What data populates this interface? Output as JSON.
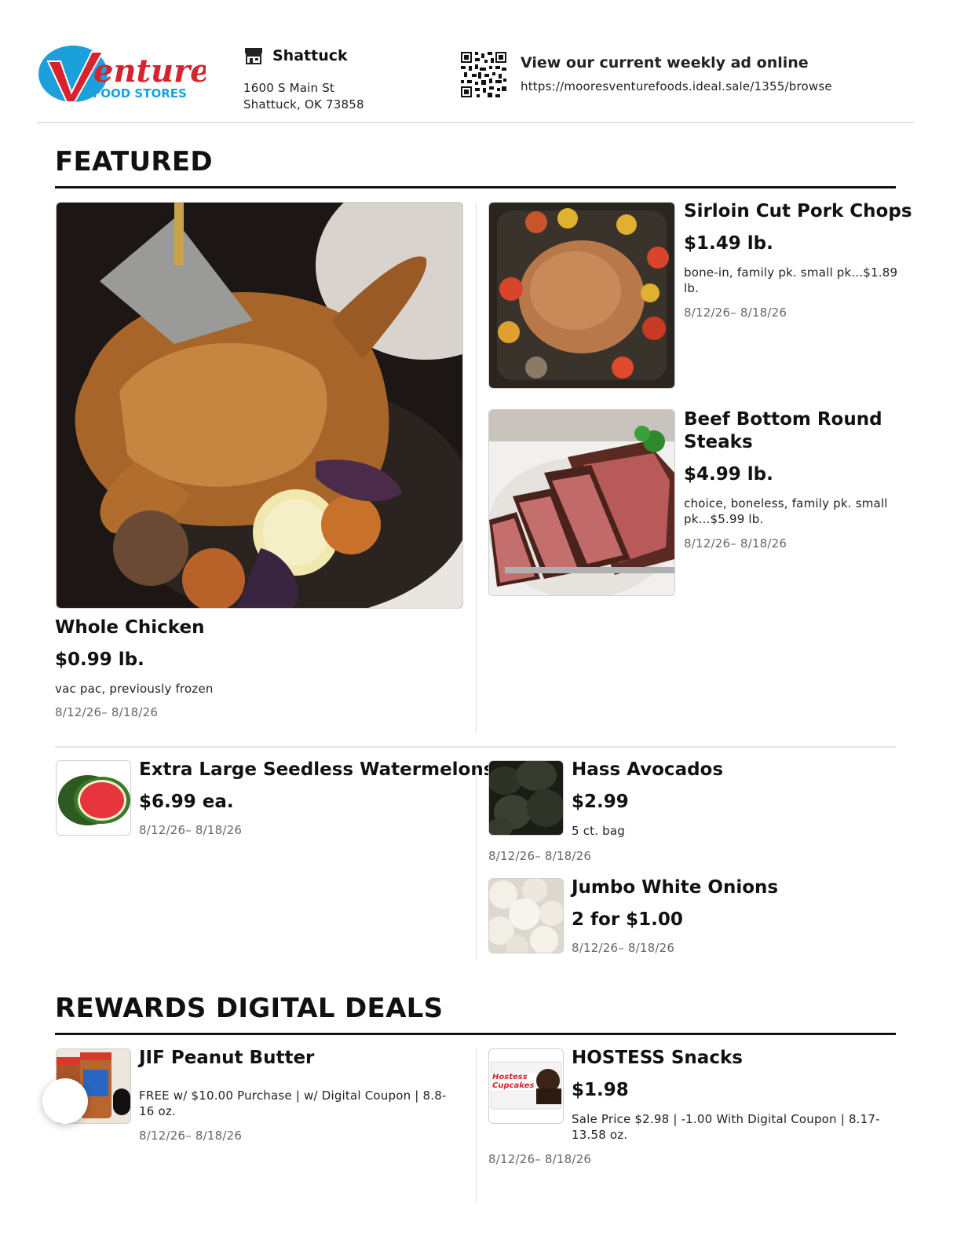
{
  "header": {
    "logo": {
      "brand": "Venture",
      "tagline": "FOOD STORES"
    },
    "store": {
      "name": "Shattuck",
      "address_line1": "1600 S Main St",
      "address_line2": "Shattuck, OK 73858"
    },
    "weekly_ad": {
      "title": "View our current weekly ad online",
      "url": "https://mooresventurefoods.ideal.sale/1355/browse"
    }
  },
  "featured": {
    "title": "FEATURED",
    "items": [
      {
        "name": "Whole Chicken",
        "price": "$0.99 lb.",
        "desc": "vac pac, previously frozen",
        "date": "8/12/26– 8/18/26"
      },
      {
        "name": "Sirloin Cut Pork Chops",
        "price": "$1.49 lb.",
        "desc": "bone-in, family pk. small pk...$1.89 lb.",
        "date": "8/12/26– 8/18/26"
      },
      {
        "name": "Beef Bottom Round Steaks",
        "price": "$4.99 lb.",
        "desc": "choice, boneless, family pk. small pk...$5.99 lb.",
        "date": "8/12/26– 8/18/26"
      },
      {
        "name": "Extra Large Seedless Watermelons",
        "price": "$6.99 ea.",
        "date": "8/12/26– 8/18/26"
      },
      {
        "name": "Hass Avocados",
        "price": "$2.99",
        "desc": "5 ct. bag",
        "date": "8/12/26– 8/18/26"
      },
      {
        "name": "Jumbo White Onions",
        "price": "2 for $1.00",
        "date": "8/12/26– 8/18/26"
      }
    ]
  },
  "rewards": {
    "title": "REWARDS DIGITAL DEALS",
    "items": [
      {
        "name": "JIF Peanut Butter",
        "desc": "FREE w/ $10.00 Purchase | w/ Digital Coupon | 8.8-16 oz.",
        "date": "8/12/26– 8/18/26"
      },
      {
        "name": "HOSTESS Snacks",
        "price": "$1.98",
        "desc": "Sale Price $2.98 | -1.00 With Digital Coupon | 8.17-13.58 oz.",
        "date": "8/12/26– 8/18/26",
        "package_text": "Hostess Cupcakes"
      }
    ]
  },
  "colors": {
    "brand_red": "#d7232e",
    "brand_blue": "#1ba0dc"
  }
}
